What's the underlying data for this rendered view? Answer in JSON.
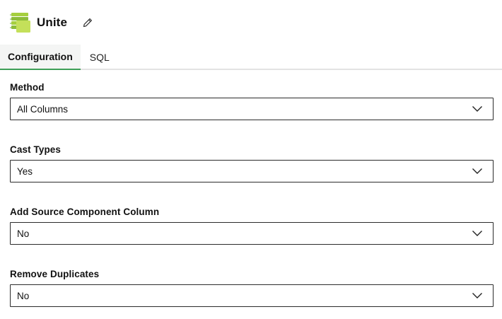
{
  "header": {
    "title": "Unite",
    "logo_icon": "stacked-tables-icon",
    "edit_icon": "pencil-icon"
  },
  "tabs": [
    {
      "label": "Configuration",
      "active": true
    },
    {
      "label": "SQL",
      "active": false
    }
  ],
  "fields": [
    {
      "label": "Method",
      "value": "All Columns"
    },
    {
      "label": "Cast Types",
      "value": "Yes"
    },
    {
      "label": "Add Source Component Column",
      "value": "No"
    },
    {
      "label": "Remove Duplicates",
      "value": "No"
    }
  ],
  "colors": {
    "accent": "#3e9f57",
    "logo_green": "#a6cf3f",
    "logo_green_dark": "#5f9e3a",
    "border": "#2b2b2b"
  }
}
